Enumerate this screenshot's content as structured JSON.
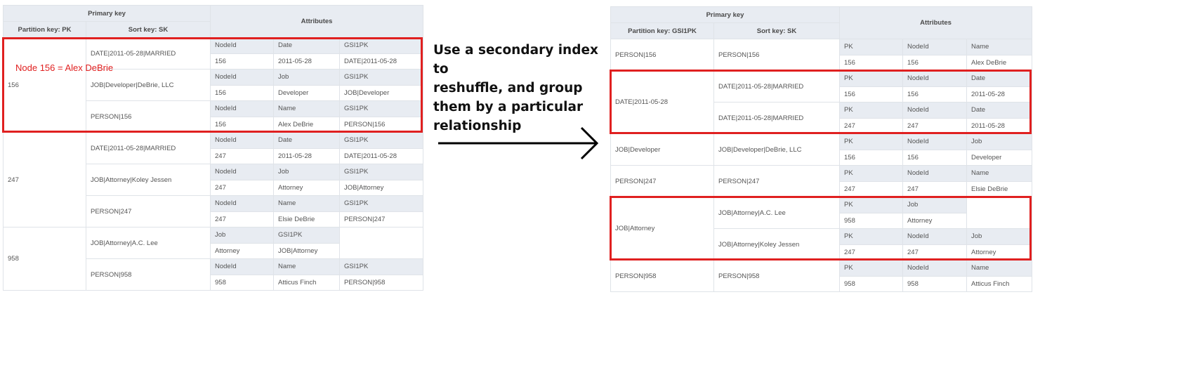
{
  "left": {
    "headers": {
      "primary_key": "Primary key",
      "attributes": "Attributes",
      "partition_key": "Partition key: PK",
      "sort_key": "Sort key: SK"
    },
    "annotation": "Node 156 = Alex DeBrie",
    "groups": [
      {
        "pk": "156",
        "items": [
          {
            "sk": "DATE|2011-05-28|MARRIED",
            "attrs": [
              [
                "NodeId",
                "156"
              ],
              [
                "Date",
                "2011-05-28"
              ],
              [
                "GSI1PK",
                "DATE|2011-05-28"
              ]
            ]
          },
          {
            "sk": "JOB|Developer|DeBrie, LLC",
            "attrs": [
              [
                "NodeId",
                "156"
              ],
              [
                "Job",
                "Developer"
              ],
              [
                "GSI1PK",
                "JOB|Developer"
              ]
            ]
          },
          {
            "sk": "PERSON|156",
            "attrs": [
              [
                "NodeId",
                "156"
              ],
              [
                "Name",
                "Alex DeBrie"
              ],
              [
                "GSI1PK",
                "PERSON|156"
              ]
            ]
          }
        ]
      },
      {
        "pk": "247",
        "items": [
          {
            "sk": "DATE|2011-05-28|MARRIED",
            "attrs": [
              [
                "NodeId",
                "247"
              ],
              [
                "Date",
                "2011-05-28"
              ],
              [
                "GSI1PK",
                "DATE|2011-05-28"
              ]
            ]
          },
          {
            "sk": "JOB|Attorney|Koley Jessen",
            "attrs": [
              [
                "NodeId",
                "247"
              ],
              [
                "Job",
                "Attorney"
              ],
              [
                "GSI1PK",
                "JOB|Attorney"
              ]
            ]
          },
          {
            "sk": "PERSON|247",
            "attrs": [
              [
                "NodeId",
                "247"
              ],
              [
                "Name",
                "Elsie DeBrie"
              ],
              [
                "GSI1PK",
                "PERSON|247"
              ]
            ]
          }
        ]
      },
      {
        "pk": "958",
        "items": [
          {
            "sk": "JOB|Attorney|A.C. Lee",
            "attrs": [
              [
                "Job",
                "Attorney"
              ],
              [
                "GSI1PK",
                "JOB|Attorney"
              ]
            ]
          },
          {
            "sk": "PERSON|958",
            "attrs": [
              [
                "NodeId",
                "958"
              ],
              [
                "Name",
                "Atticus Finch"
              ],
              [
                "GSI1PK",
                "PERSON|958"
              ]
            ]
          }
        ]
      }
    ]
  },
  "middle": {
    "explanation": [
      "Use a secondary index to",
      "reshuffle, and group",
      "them by a particular",
      "relationship"
    ]
  },
  "right": {
    "headers": {
      "primary_key": "Primary key",
      "attributes": "Attributes",
      "partition_key": "Partition key: GSI1PK",
      "sort_key": "Sort key: SK"
    },
    "groups": [
      {
        "pk": "PERSON|156",
        "items": [
          {
            "sk": "PERSON|156",
            "attrs": [
              [
                "PK",
                "156"
              ],
              [
                "NodeId",
                "156"
              ],
              [
                "Name",
                "Alex DeBrie"
              ]
            ]
          }
        ]
      },
      {
        "pk": "DATE|2011-05-28",
        "items": [
          {
            "sk": "DATE|2011-05-28|MARRIED",
            "attrs": [
              [
                "PK",
                "156"
              ],
              [
                "NodeId",
                "156"
              ],
              [
                "Date",
                "2011-05-28"
              ]
            ]
          },
          {
            "sk": "DATE|2011-05-28|MARRIED",
            "attrs": [
              [
                "PK",
                "247"
              ],
              [
                "NodeId",
                "247"
              ],
              [
                "Date",
                "2011-05-28"
              ]
            ]
          }
        ]
      },
      {
        "pk": "JOB|Developer",
        "items": [
          {
            "sk": "JOB|Developer|DeBrie, LLC",
            "attrs": [
              [
                "PK",
                "156"
              ],
              [
                "NodeId",
                "156"
              ],
              [
                "Job",
                "Developer"
              ]
            ]
          }
        ]
      },
      {
        "pk": "PERSON|247",
        "items": [
          {
            "sk": "PERSON|247",
            "attrs": [
              [
                "PK",
                "247"
              ],
              [
                "NodeId",
                "247"
              ],
              [
                "Name",
                "Elsie DeBrie"
              ]
            ]
          }
        ]
      },
      {
        "pk": "JOB|Attorney",
        "items": [
          {
            "sk": "JOB|Attorney|A.C. Lee",
            "attrs": [
              [
                "PK",
                "958"
              ],
              [
                "Job",
                "Attorney"
              ]
            ]
          },
          {
            "sk": "JOB|Attorney|Koley Jessen",
            "attrs": [
              [
                "PK",
                "247"
              ],
              [
                "NodeId",
                "247"
              ],
              [
                "Job",
                "Attorney"
              ]
            ]
          }
        ]
      },
      {
        "pk": "PERSON|958",
        "items": [
          {
            "sk": "PERSON|958",
            "attrs": [
              [
                "PK",
                "958"
              ],
              [
                "NodeId",
                "958"
              ],
              [
                "Name",
                "Atticus Finch"
              ]
            ]
          }
        ]
      }
    ]
  }
}
